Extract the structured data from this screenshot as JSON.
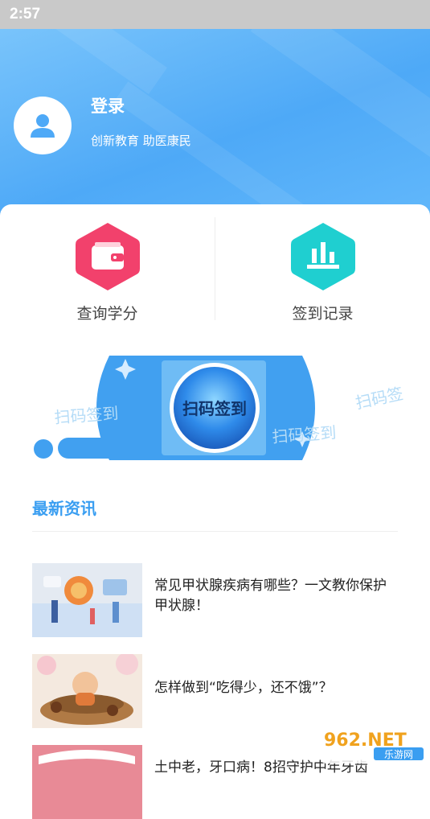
{
  "status_bar": {
    "time": "2:57"
  },
  "profile": {
    "login_label": "登录",
    "slogan": "创新教育 助医康民"
  },
  "quick_actions": [
    {
      "label": "查询学分",
      "icon": "wallet-icon",
      "color": "#f2416c"
    },
    {
      "label": "签到记录",
      "icon": "bar-chart-icon",
      "color": "#1fcfd0"
    }
  ],
  "scan_banner": {
    "button_label": "扫码签到",
    "deco_left": "扫码签到",
    "deco_right": "扫码签到",
    "deco_far_right": "扫码签"
  },
  "news": {
    "section_title": "最新资讯",
    "items": [
      {
        "title": "常见甲状腺疾病有哪些？一文教你保护甲状腺！"
      },
      {
        "title": "怎样做到“吃得少，还不饿”？"
      },
      {
        "title": "土中老，牙口病！8招守护中年牙齿"
      }
    ]
  },
  "watermark": {
    "brand": "962.NET",
    "sub": "乐游网"
  },
  "colors": {
    "accent": "#3a9ef1",
    "hero": "#4ea9f7"
  }
}
